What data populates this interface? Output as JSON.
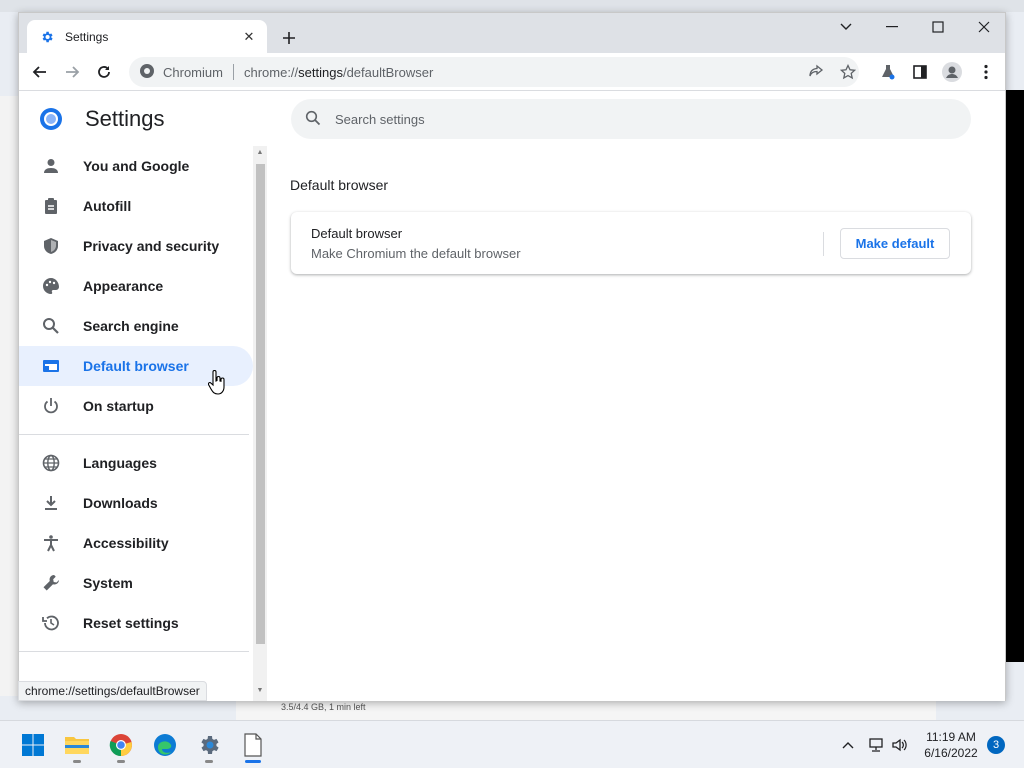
{
  "browser": {
    "tab": {
      "title": "Settings"
    },
    "omnibox": {
      "site_name": "Chromium",
      "url_prefix": "chrome://",
      "url_path": "settings",
      "url_rest": "/defaultBrowser"
    }
  },
  "settings": {
    "header_title": "Settings",
    "search_placeholder": "Search settings",
    "sidebar": {
      "items": [
        {
          "label": "You and Google",
          "icon": "person-icon"
        },
        {
          "label": "Autofill",
          "icon": "clipboard-icon"
        },
        {
          "label": "Privacy and security",
          "icon": "shield-icon"
        },
        {
          "label": "Appearance",
          "icon": "palette-icon"
        },
        {
          "label": "Search engine",
          "icon": "search-icon"
        },
        {
          "label": "Default browser",
          "icon": "browser-icon",
          "active": true
        },
        {
          "label": "On startup",
          "icon": "power-icon"
        }
      ],
      "items2": [
        {
          "label": "Languages",
          "icon": "globe-icon"
        },
        {
          "label": "Downloads",
          "icon": "download-icon"
        },
        {
          "label": "Accessibility",
          "icon": "accessibility-icon"
        },
        {
          "label": "System",
          "icon": "wrench-icon"
        },
        {
          "label": "Reset settings",
          "icon": "history-icon"
        }
      ]
    },
    "section_title": "Default browser",
    "card": {
      "title": "Default browser",
      "subtitle": "Make Chromium the default browser",
      "button_label": "Make default"
    },
    "status_url": "chrome://settings/defaultBrowser"
  },
  "background": {
    "download_text": "3.5/4.4 GB, 1 min left"
  },
  "taskbar": {
    "time": "11:19 AM",
    "date": "6/16/2022",
    "notifications": "3"
  },
  "colors": {
    "accent": "#1a73e8",
    "active_bg": "#e8f0fe"
  }
}
